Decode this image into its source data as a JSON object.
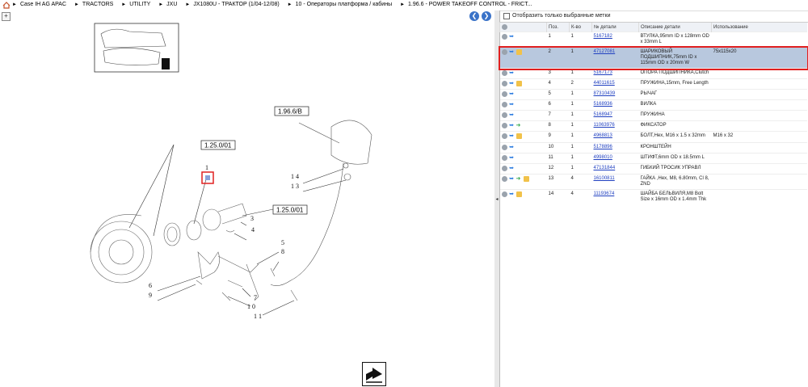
{
  "breadcrumb": [
    "Case IH AG APAC",
    "TRACTORS",
    "UTILITY",
    "JXU",
    "JX1080U - ТРАКТОР (1/04-12/08)",
    "10 - Операторы платформа / кабины",
    "1.96.6 - POWER TAKEOFF CONTROL - FRICT..."
  ],
  "filter": {
    "label": "Отобразить только выбранные метки"
  },
  "table": {
    "headers": [
      "Поз.",
      "К-во",
      "№ детали",
      "Описание детали",
      "Использование"
    ],
    "rows": [
      {
        "pos": "1",
        "qty": "1",
        "part": "5167182",
        "desc": "ВТУЛКА,95mm ID x 128mm OD x 33mm L",
        "use": "",
        "icons": [
          "g",
          "b"
        ]
      },
      {
        "pos": "2",
        "qty": "1",
        "part": "47127081",
        "desc": "ШАРИКОВЫЙ ПОДШИПНИК,75mm ID x 115mm OD x 20mm W",
        "use": "75x115x20",
        "icons": [
          "g",
          "b",
          "y"
        ]
      },
      {
        "pos": "3",
        "qty": "1",
        "part": "5167173",
        "desc": "ОПОРА ПОДШИПНИКА,Clutch",
        "use": "",
        "icons": [
          "g",
          "b"
        ]
      },
      {
        "pos": "4",
        "qty": "2",
        "part": "44011615",
        "desc": "ПРУЖИНА,15mm, Free Length",
        "use": "",
        "icons": [
          "g",
          "b",
          "y"
        ]
      },
      {
        "pos": "5",
        "qty": "1",
        "part": "87310439",
        "desc": "РЫЧАГ",
        "use": "",
        "icons": [
          "g",
          "b"
        ]
      },
      {
        "pos": "6",
        "qty": "1",
        "part": "5168936",
        "desc": "ВИЛКА",
        "use": "",
        "icons": [
          "g",
          "b"
        ]
      },
      {
        "pos": "7",
        "qty": "1",
        "part": "5168947",
        "desc": "ПРУЖИНА",
        "use": "",
        "icons": [
          "g",
          "b"
        ]
      },
      {
        "pos": "8",
        "qty": "1",
        "part": "11063976",
        "desc": "ФИКСАТОР",
        "use": "",
        "icons": [
          "g",
          "b",
          "gr"
        ]
      },
      {
        "pos": "9",
        "qty": "1",
        "part": "4968813",
        "desc": "БОЛТ,Hex, M16 x 1.5 x 32mm",
        "use": "M16 x 32",
        "icons": [
          "g",
          "b",
          "y"
        ]
      },
      {
        "pos": "10",
        "qty": "1",
        "part": "5178896",
        "desc": "КРОНШТЕЙН",
        "use": "",
        "icons": [
          "g",
          "b"
        ]
      },
      {
        "pos": "11",
        "qty": "1",
        "part": "4998010",
        "desc": "ШТИФТ,6mm OD x 18.5mm L",
        "use": "",
        "icons": [
          "g",
          "b"
        ]
      },
      {
        "pos": "12",
        "qty": "1",
        "part": "47131844",
        "desc": "ГИБКИЙ ТРОСИК УПРАВЛ",
        "use": "",
        "icons": [
          "g",
          "b"
        ]
      },
      {
        "pos": "13",
        "qty": "4",
        "part": "16100811",
        "desc": "ГАЙКА ,Hex, M8, 6.80mm, Cl 8, ZND",
        "use": "",
        "icons": [
          "g",
          "b",
          "gr",
          "y"
        ]
      },
      {
        "pos": "14",
        "qty": "4",
        "part": "11193674",
        "desc": "ШАЙБА БЕЛЬВИЛЯ,M8 Bolt Size x 16mm OD x 1.4mm Thk",
        "use": "",
        "icons": [
          "g",
          "b",
          "y"
        ]
      }
    ]
  },
  "diagram": {
    "refs": [
      "1.96.6/B",
      "1.25.0/01",
      "1.25.0/01"
    ],
    "labels": [
      "1",
      "2",
      "3",
      "4",
      "5",
      "6",
      "7",
      "8",
      "9",
      "1 0",
      "1 1",
      "1 3",
      "1 4"
    ]
  },
  "colors": {
    "accent": "#3b73c8",
    "selected_row": "#b8c8de",
    "highlight": "#e02020"
  }
}
